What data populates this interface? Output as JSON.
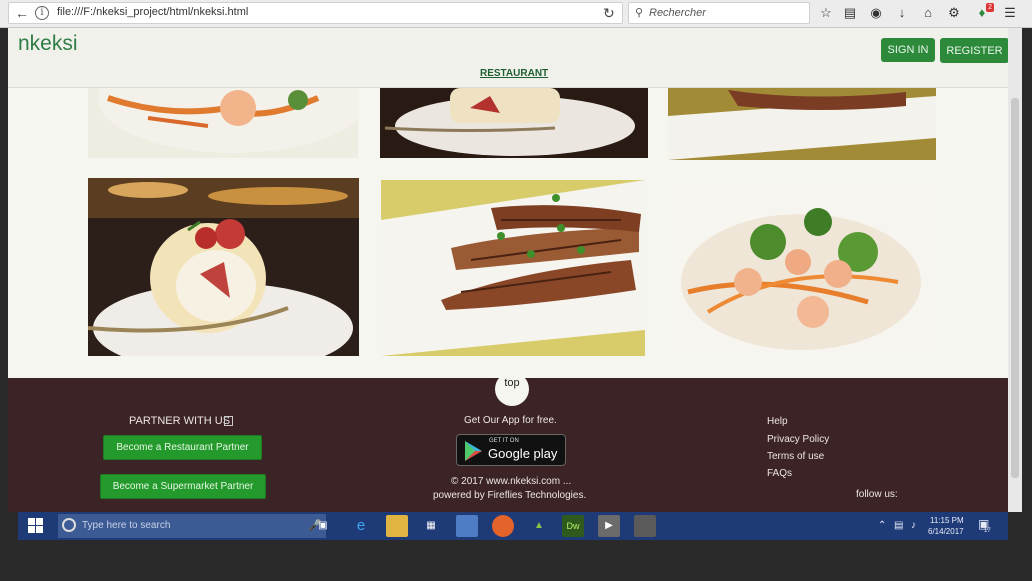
{
  "browser": {
    "url": "file:///F:/nkeksi_project/html/nkeksi.html",
    "search_placeholder": "Rechercher",
    "notification_count": "2"
  },
  "site": {
    "logo": "nkeksi",
    "sign_in_label": "SIGN IN",
    "register_label": "REGISTER",
    "nav_restaurant": "RESTAURANT",
    "top_label": "top"
  },
  "gallery": [
    {
      "name": "shrimp-salad-top"
    },
    {
      "name": "cake-roll-top"
    },
    {
      "name": "grilled-chicken-top"
    },
    {
      "name": "cake-roll"
    },
    {
      "name": "grilled-chicken"
    },
    {
      "name": "shrimp-salad"
    }
  ],
  "footer": {
    "partner_heading": "PARTNER WITH US",
    "restaurant_partner": "Become a Restaurant Partner",
    "supermarket_partner": "Become a Supermarket Partner",
    "app_heading": "Get Our App for free.",
    "gp_small": "GET IT ON",
    "gp_big": "Google play",
    "copyright": "© 2017 www.nkeksi.com ...",
    "powered": "powered by Fireflies Technologies.",
    "links": [
      "Help",
      "Privacy Policy",
      "Terms of use",
      "FAQs"
    ],
    "follow": "follow us:"
  },
  "taskbar": {
    "search_placeholder": "Type here to search",
    "time": "11:15 PM",
    "date": "6/14/2017",
    "notif_count": "17"
  },
  "colors": {
    "brand_green": "#2d8a3b",
    "footer_bg": "#3c2326",
    "taskbar_bg": "#1e3b78"
  }
}
